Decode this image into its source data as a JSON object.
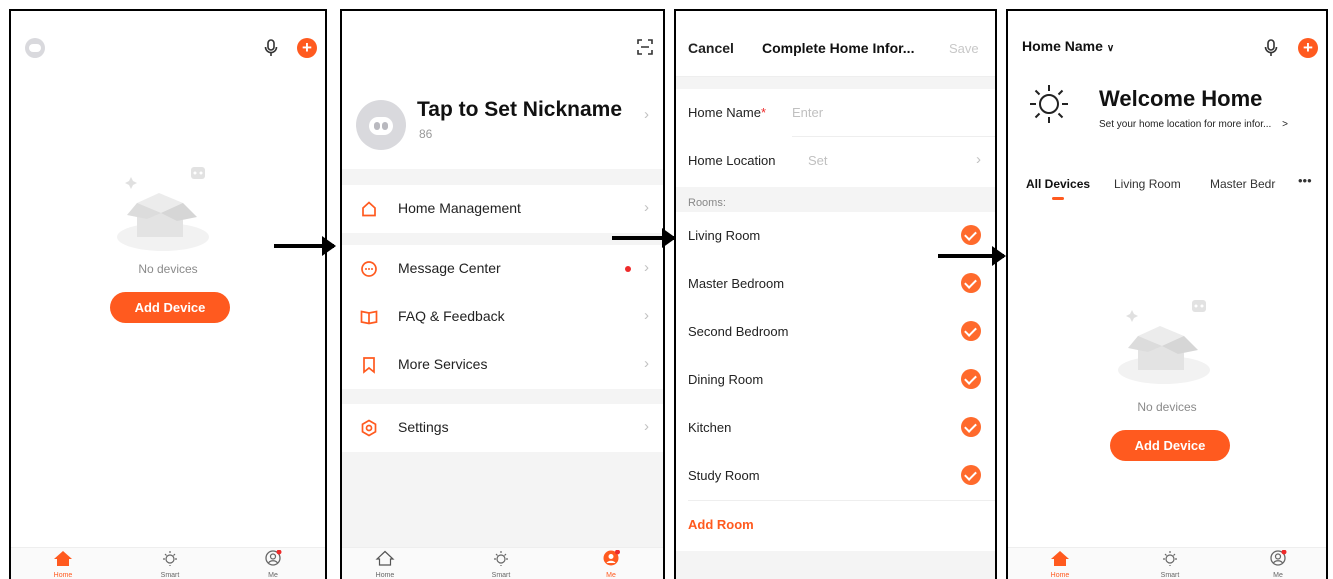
{
  "screen1": {
    "no_devices": "No devices",
    "add_device": "Add Device",
    "tabs": [
      "Home",
      "Smart",
      "Me"
    ]
  },
  "screen2": {
    "nickname": "Tap to Set Nickname",
    "user_id": "86",
    "menu": [
      {
        "label": "Home Management",
        "icon": "home-outline-icon"
      },
      {
        "label": "Message Center",
        "icon": "message-icon"
      },
      {
        "label": "FAQ & Feedback",
        "icon": "book-icon"
      },
      {
        "label": "More Services",
        "icon": "bookmark-icon"
      },
      {
        "label": "Settings",
        "icon": "settings-icon"
      }
    ],
    "tabs": [
      "Home",
      "Smart",
      "Me"
    ]
  },
  "screen3": {
    "cancel": "Cancel",
    "title": "Complete Home Infor...",
    "save": "Save",
    "home_name_label": "Home Name",
    "home_name_required": "*",
    "home_name_placeholder": "Enter",
    "home_location_label": "Home Location",
    "home_location_value": "Set",
    "rooms_label": "Rooms:",
    "rooms": [
      "Living Room",
      "Master Bedroom",
      "Second Bedroom",
      "Dining Room",
      "Kitchen",
      "Study Room"
    ],
    "add_room": "Add Room"
  },
  "screen4": {
    "home_name": "Home Name",
    "welcome": "Welcome Home",
    "subtitle": "Set your home location for more infor...",
    "subtitle_chevron": ">",
    "tabs": [
      "All Devices",
      "Living Room",
      "Master Bedr"
    ],
    "more": "•••",
    "no_devices": "No devices",
    "add_device": "Add Device",
    "nav": [
      "Home",
      "Smart",
      "Me"
    ]
  },
  "colors": {
    "accent": "#ff5a1f",
    "badge": "#ee2a2a"
  }
}
